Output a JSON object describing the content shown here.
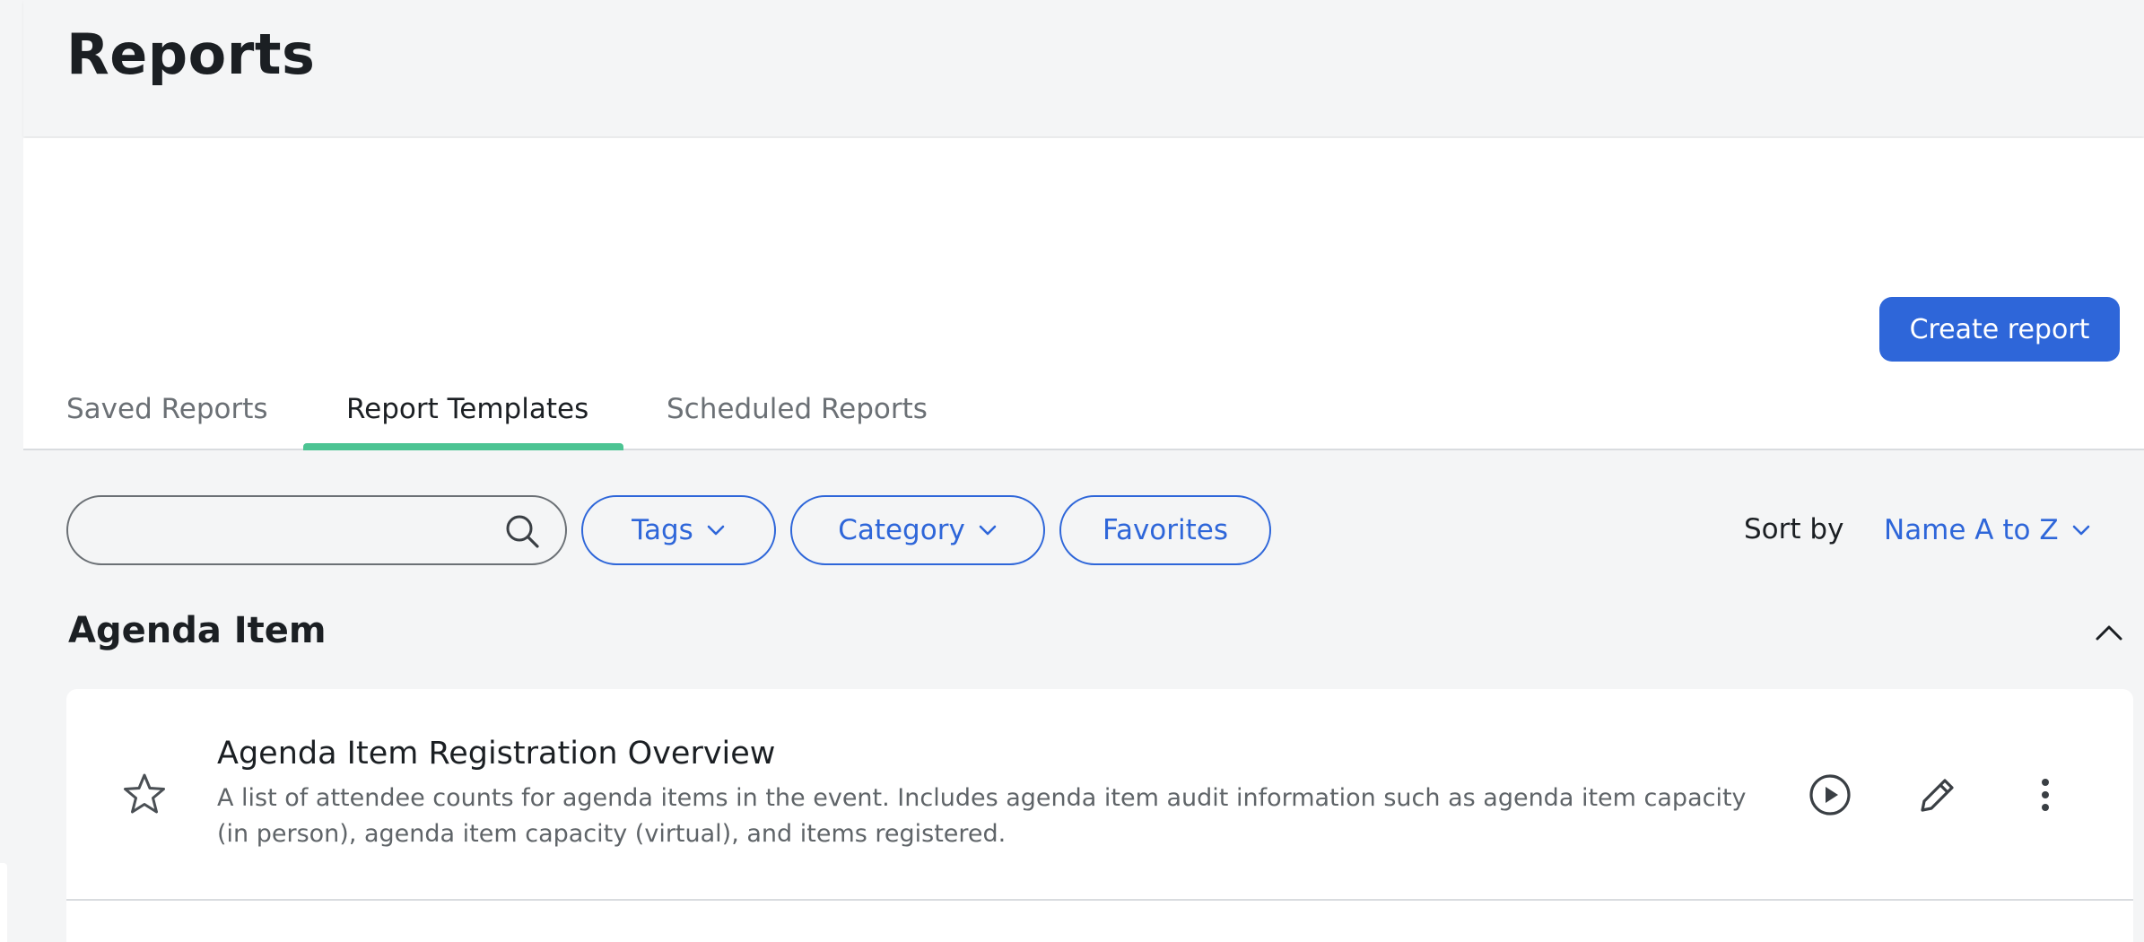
{
  "page": {
    "title": "Reports"
  },
  "actions": {
    "create_report_label": "Create report"
  },
  "tabs": [
    {
      "label": "Saved Reports",
      "active": false
    },
    {
      "label": "Report Templates",
      "active": true
    },
    {
      "label": "Scheduled Reports",
      "active": false
    }
  ],
  "filters": {
    "search": {
      "value": "",
      "placeholder": ""
    },
    "tags_label": "Tags",
    "category_label": "Category",
    "favorites_label": "Favorites",
    "sort_label": "Sort by",
    "sort_value": "Name A to Z"
  },
  "section": {
    "title": "Agenda Item",
    "collapsed": false,
    "items": [
      {
        "title": "Agenda Item Registration Overview",
        "description_line1": "A list of attendee counts for agenda items in the event. Includes agenda item audit information such as agenda item capacity",
        "description_line2": "(in person), agenda item capacity (virtual), and items registered.",
        "favorite": false
      }
    ]
  },
  "colors": {
    "accent_blue": "#2e66d9",
    "tab_active_underline": "#4cc493",
    "page_background": "#f4f5f6",
    "card_background": "#ffffff"
  },
  "icons": [
    "search-icon",
    "chevron-down-icon",
    "chevron-up-icon",
    "star-icon",
    "play-icon",
    "pencil-icon",
    "more-vertical-icon"
  ]
}
